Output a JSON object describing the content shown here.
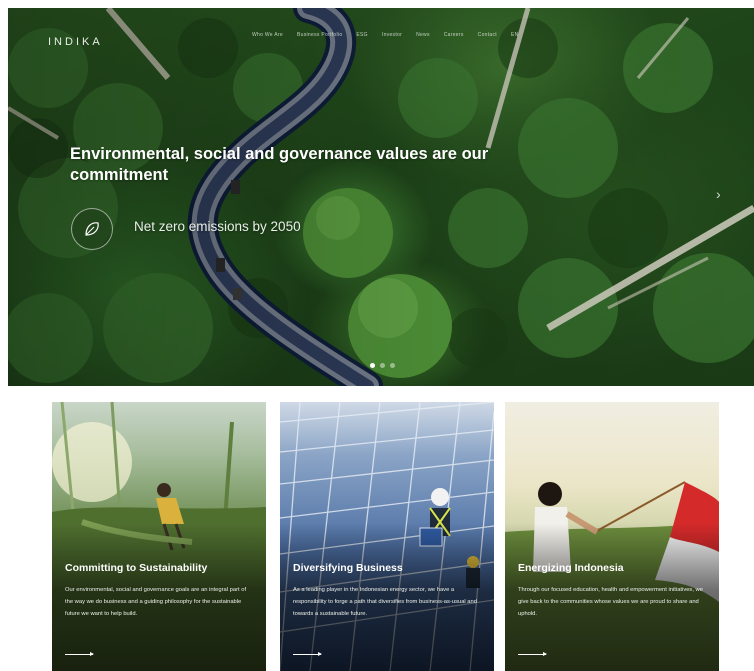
{
  "header": {
    "logo": "INDIKA",
    "nav": [
      "Who We Are",
      "Business Portfolio",
      "ESG",
      "Investor",
      "News",
      "Careers",
      "Contact",
      "EN"
    ]
  },
  "hero": {
    "headline": "Environmental, social and governance values are our commitment",
    "tagline": "Net zero emissions by 2050",
    "icon": "leaf-icon",
    "slides": 3,
    "active_slide": 1
  },
  "cards": [
    {
      "title": "Committing to Sustainability",
      "text": "Our environmental, social and governance goals are an integral part of the way we do business and a guiding philosophy for the sustainable future we want to help build."
    },
    {
      "title": "Diversifying Business",
      "text": "As a leading player in the Indonesian energy sector, we have a responsibility to forge a path that diversifies from business-as-usual and towards a sustainable future."
    },
    {
      "title": "Energizing Indonesia",
      "text": "Through our focused education, health and empowerment initiatives, we give back to the communities whose values we are proud to share and uphold."
    }
  ]
}
